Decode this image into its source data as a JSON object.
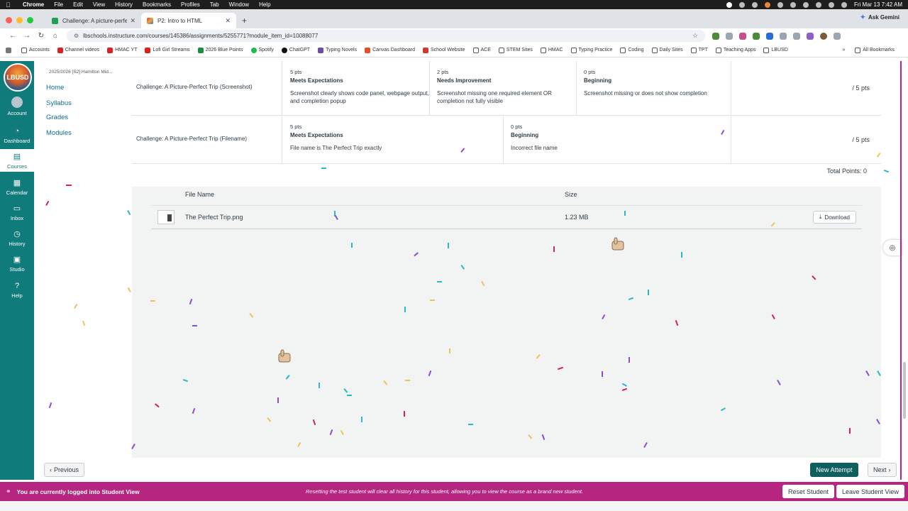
{
  "menubar": {
    "app": "Chrome",
    "items": [
      "File",
      "Edit",
      "View",
      "History",
      "Bookmarks",
      "Profiles",
      "Tab",
      "Window",
      "Help"
    ],
    "datetime": "Fri Mar 13  7:42 AM"
  },
  "browser": {
    "tabs": [
      {
        "title": "Challenge: A picture-perfect"
      },
      {
        "title": "P2: Intro to HTML"
      }
    ],
    "ask_gemini": "Ask Gemini",
    "url": "lbschools.instructure.com/courses/145386/assignments/5255771?module_item_id=10088077",
    "bookmarks": [
      "Accounts",
      "Channel videos",
      "HMAC YT",
      "Lofi Girl Streams",
      "2026 Blue Points",
      "Spotify",
      "ChatGPT",
      "Typing Novels",
      "Canvas Dashboard",
      "School Website",
      "ACE",
      "STEM Sites",
      "HMAC",
      "Typing Practice",
      "Coding",
      "Daily Sites",
      "TPT",
      "Teaching Apps",
      "LBUSD"
    ],
    "all_bookmarks": "All Bookmarks"
  },
  "global_nav": {
    "logo": "LBUSD",
    "items": [
      {
        "label": "Account",
        "icon": "account-icon"
      },
      {
        "label": "Dashboard",
        "icon": "dashboard-icon"
      },
      {
        "label": "Courses",
        "icon": "courses-icon"
      },
      {
        "label": "Calendar",
        "icon": "calendar-icon"
      },
      {
        "label": "Inbox",
        "icon": "inbox-icon"
      },
      {
        "label": "History",
        "icon": "history-icon"
      },
      {
        "label": "Studio",
        "icon": "studio-icon"
      },
      {
        "label": "Help",
        "icon": "help-icon"
      }
    ]
  },
  "course_nav": {
    "term": "2025/2026 [S2] Hamilton Mid...",
    "links": [
      "Home",
      "Syllabus",
      "Grades",
      "Modules"
    ]
  },
  "rubric": {
    "rows": [
      {
        "criterion": "Challenge: A Picture-Perfect Trip (Screenshot)",
        "ratings": [
          {
            "pts": "5 pts",
            "level": "Meets Expectations",
            "desc": "Screenshot clearly shows code panel, webpage output, and completion popup"
          },
          {
            "pts": "2 pts",
            "level": "Needs Improvement",
            "desc": "Screenshot missing one required element OR completion not fully visible"
          },
          {
            "pts": "0 pts",
            "level": "Beginning",
            "desc": "Screenshot missing or does not show completion"
          }
        ],
        "score": "/ 5 pts"
      },
      {
        "criterion": "Challenge: A Picture-Perfect Trip (Filename)",
        "ratings": [
          {
            "pts": "5 pts",
            "level": "Meets Expectations",
            "desc": "File name is The Perfect Trip exactly"
          },
          {
            "pts": "0 pts",
            "level": "Beginning",
            "desc": "Incorrect file name"
          }
        ],
        "score": "/ 5 pts"
      }
    ],
    "total": "Total Points: 0"
  },
  "files": {
    "header_name": "File Name",
    "header_size": "Size",
    "rows": [
      {
        "name": "The Perfect Trip.png",
        "size": "1.23 MB",
        "action": "Download"
      }
    ]
  },
  "footer": {
    "previous": "Previous",
    "new_attempt": "New Attempt",
    "next": "Next"
  },
  "student_bar": {
    "title": "You are currently logged into Student View",
    "note": "Resetting the test student will clear all history for this student, allowing you to view the course as a brand new student.",
    "reset": "Reset Student",
    "leave": "Leave Student View"
  },
  "colors": {
    "nav_teal": "#0f7b7a",
    "student_magenta": "#b6257f",
    "new_attempt": "#0e5f5e",
    "link": "#0c6f8f"
  }
}
